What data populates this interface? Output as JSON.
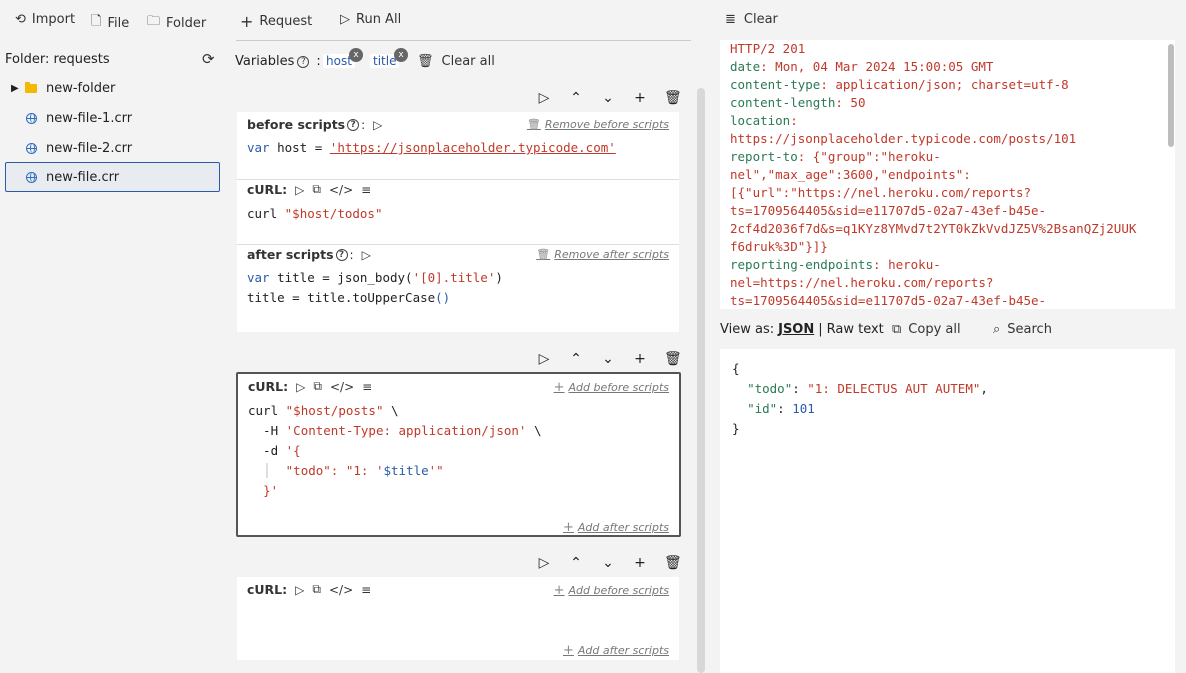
{
  "toolbar": {
    "import": "Import",
    "file": "File",
    "folder": "Folder",
    "request": "Request",
    "run_all": "Run All",
    "clear": "Clear"
  },
  "sidebar": {
    "folder_title": "Folder: requests",
    "items": [
      {
        "label": "new-folder",
        "type": "folder"
      },
      {
        "label": "new-file-1.crr",
        "type": "file"
      },
      {
        "label": "new-file-2.crr",
        "type": "file"
      },
      {
        "label": "new-file.crr",
        "type": "file",
        "active": true
      }
    ]
  },
  "variables": {
    "label": "Variables",
    "chips": [
      "host",
      "title"
    ],
    "clear_all": "Clear all"
  },
  "cards": [
    {
      "before_label": "before scripts",
      "before_link": "Remove before scripts",
      "before_code": [
        "var host = ",
        "'https://jsonplaceholder.typicode.com'"
      ],
      "curl_label": "cURL:",
      "curl_code": [
        "curl ",
        "\"$host/todos\""
      ],
      "after_label": "after scripts",
      "after_link": "Remove after scripts",
      "after_code_1": [
        "var title = json_body(",
        "'[0].title'",
        ")"
      ],
      "after_code_2": [
        "title = title.toUpperCase",
        "()"
      ]
    },
    {
      "curl_label": "cURL:",
      "before_link": "Add before scripts",
      "after_link": "Add after scripts",
      "lines": [
        "curl \"$host/posts\" \\",
        "  -H 'Content-Type: application/json' \\",
        "  -d '{",
        "  │  \"todo\": \"1: '$title'\"",
        "  }'"
      ]
    },
    {
      "curl_label": "cURL:",
      "before_link": "Add before scripts",
      "after_link": "Add after scripts"
    }
  ],
  "response": {
    "lines": [
      {
        "k": "",
        "v": "HTTP/2 201"
      },
      {
        "k": "date",
        "v": "Mon, 04 Mar 2024 15:00:05 GMT"
      },
      {
        "k": "content-type",
        "v": "application/json; charset=utf-8"
      },
      {
        "k": "content-length",
        "v": "50"
      },
      {
        "k": "location",
        "v": ""
      },
      {
        "k": "",
        "v": "https://jsonplaceholder.typicode.com/posts/101"
      },
      {
        "k": "report-to",
        "v": "{\"group\":\"heroku-"
      },
      {
        "k": "",
        "v": "nel\",\"max_age\":3600,\"endpoints\":"
      },
      {
        "k": "",
        "v": "[{\"url\":\"https://nel.heroku.com/reports?"
      },
      {
        "k": "",
        "v": "ts=1709564405&sid=e11707d5-02a7-43ef-b45e-"
      },
      {
        "k": "",
        "v": "2cf4d2036f7d&s=q1KYz8YMvd7t2YT0kZkVvdJZ5V%2BsanQZj2UUK"
      },
      {
        "k": "",
        "v": "f6druk%3D\"}]}"
      },
      {
        "k": "reporting-endpoints",
        "v": "heroku-"
      },
      {
        "k": "",
        "v": "nel=https://nel.heroku.com/reports?"
      },
      {
        "k": "",
        "v": "ts=1709564405&sid=e11707d5-02a7-43ef-b45e-"
      }
    ]
  },
  "view": {
    "label": "View as:",
    "json": "JSON",
    "sep": "|",
    "raw": "Raw text",
    "copy_all": "Copy all",
    "search": "Search"
  },
  "json_body": {
    "todo_key": "\"todo\"",
    "todo_val": "\"1: DELECTUS AUT AUTEM\"",
    "id_key": "\"id\"",
    "id_val": "101"
  }
}
